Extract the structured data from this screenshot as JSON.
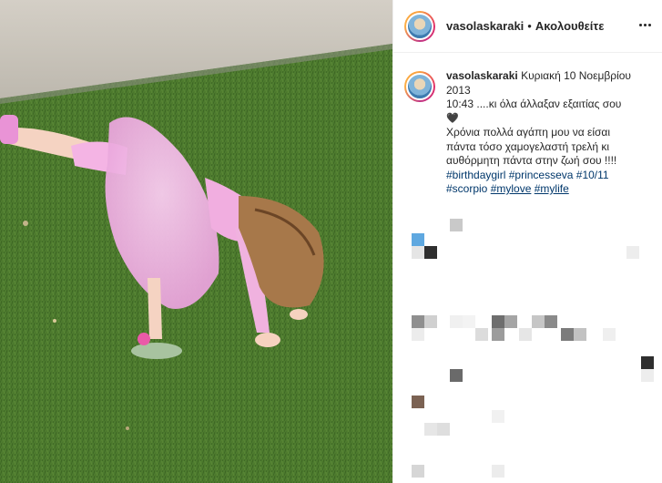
{
  "header": {
    "username": "vasolaskaraki",
    "separator": "•",
    "follow_status": "Ακολουθείτε"
  },
  "caption": {
    "username": "vasolaskaraki",
    "date_line1": "Κυριακή 10 Νοεμβρίου",
    "date_line2": "2013",
    "line1": "10:43 ....κι όλα άλλαξαν εξαιτίας σου",
    "heart": "🖤",
    "line2": "Χρόνια πολλά αγάπη μου να είσαι",
    "line3": "πάντα τόσο χαμογελαστή τρελή κι",
    "line4": "αυθόρμητη πάντα στην ζωή σου !!!!",
    "hashtags_line1": [
      "#birthdaygirl",
      "#princesseva",
      "#10/11"
    ],
    "hashtags_line2": [
      "#scorpio",
      "#mylove",
      "#mylife"
    ]
  },
  "colors": {
    "grass": "#4d7a30",
    "wall": "#d8d4cc",
    "dress": "#f3b5e6",
    "hashtag": "#00376b"
  }
}
